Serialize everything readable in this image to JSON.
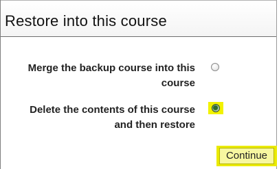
{
  "dialog": {
    "title": "Restore into this course"
  },
  "options": [
    {
      "line1": "Merge the backup course into this",
      "line2": "course",
      "selected": false
    },
    {
      "line1": "Delete the contents of this course",
      "line2": "and then restore",
      "selected": true
    }
  ],
  "actions": {
    "continue_label": "Continue"
  },
  "colors": {
    "highlight": "#eaea00",
    "border": "#7f7f7f"
  }
}
